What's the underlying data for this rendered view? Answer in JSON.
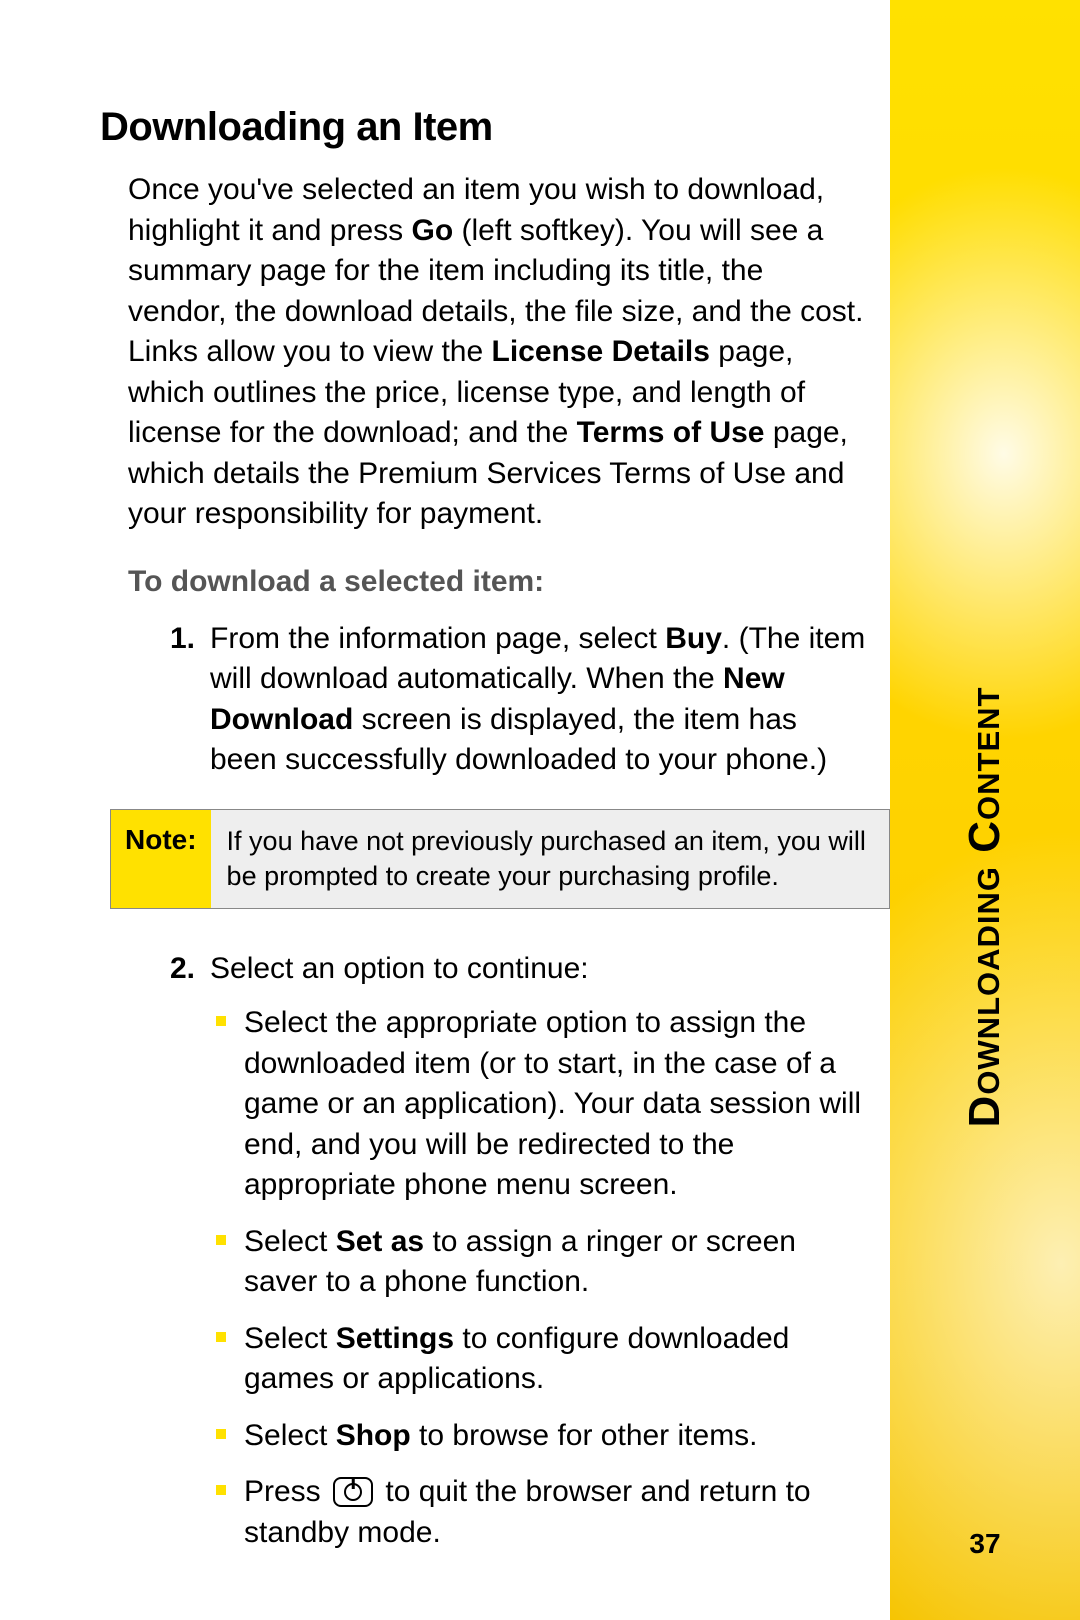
{
  "sideTab": "Downloading Content",
  "pageNumber": "37",
  "heading": "Downloading an Item",
  "intro": {
    "pre": "Once you've selected an item you wish to download, highlight it and press ",
    "b1": "Go",
    "mid1": " (left softkey). You will see a summary page for the item including its title, the vendor, the download details, the file size, and the cost. Links allow you to view the ",
    "b2": "License Details",
    "mid2": " page, which outlines the price, license type, and length of license for the download; and the ",
    "b3": "Terms of Use",
    "post": " page, which details the Premium Services Terms of Use and your responsibility for payment."
  },
  "subhead": "To download a selected item:",
  "step1": {
    "num": "1.",
    "pre": "From the information page, select ",
    "b1": "Buy",
    "mid1": ". (The item will download automatically. When the ",
    "b2": "New Download",
    "post": " screen is displayed, the item has been successfully downloaded to your phone.)"
  },
  "note": {
    "label": "Note:",
    "text": "If you have not previously purchased an item, you will be prompted to create your purchasing profile."
  },
  "step2": {
    "num": "2.",
    "lead": "Select an option to continue:",
    "bul1": "Select the appropriate option to assign the downloaded item (or to start, in the case of a game or an application). Your data session will end, and you will be redirected to the appropriate phone menu screen.",
    "bul2": {
      "pre": "Select ",
      "b": "Set as",
      "post": " to assign a ringer or screen saver to a phone function."
    },
    "bul3": {
      "pre": "Select ",
      "b": "Settings",
      "post": " to configure downloaded games or applications."
    },
    "bul4": {
      "pre": "Select ",
      "b": "Shop",
      "post": " to browse for other items."
    },
    "bul5": {
      "pre": "Press ",
      "post": " to quit the browser and return to standby mode."
    }
  }
}
